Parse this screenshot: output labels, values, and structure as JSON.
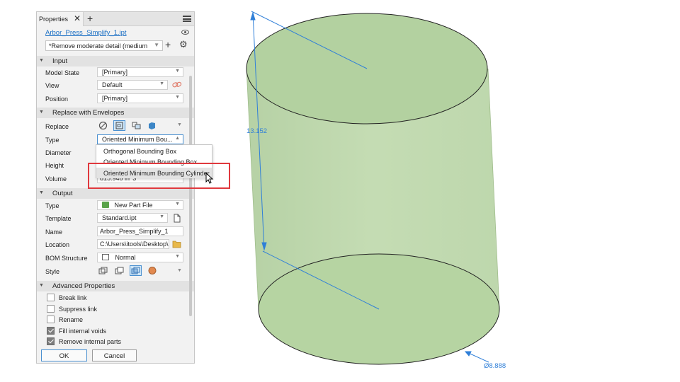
{
  "panel": {
    "tab_label": "Properties",
    "tab_close": "✕",
    "tab_add": "+",
    "file_link": "Arbor_Press_Simplify_1.ipt",
    "preset_value": "*Remove moderate detail (medium",
    "preset_add": "+",
    "gear": "⚙"
  },
  "input": {
    "title": "Input",
    "model_state_label": "Model State",
    "model_state_value": "[Primary]",
    "view_label": "View",
    "view_value": "Default",
    "position_label": "Position",
    "position_value": "[Primary]"
  },
  "envelopes": {
    "title": "Replace with Envelopes",
    "replace_label": "Replace",
    "type_label": "Type",
    "type_value": "Oriented Minimum Bou...",
    "diameter_label": "Diameter",
    "height_label": "Height",
    "volume_label": "Volume",
    "volume_value": "815.946 in^3",
    "type_options": [
      "Orthogonal Bounding Box",
      "Oriented Minimum Bounding Box",
      "Oriented Minimum Bounding Cylinder"
    ]
  },
  "output": {
    "title": "Output",
    "type_label": "Type",
    "type_value": "New Part File",
    "template_label": "Template",
    "template_value": "Standard.ipt",
    "name_label": "Name",
    "name_value": "Arbor_Press_Simplify_1",
    "location_label": "Location",
    "location_value": "C:\\Users\\itools\\Desktop\\",
    "bom_label": "BOM Structure",
    "bom_value": "Normal",
    "style_label": "Style"
  },
  "advanced": {
    "title": "Advanced Properties",
    "options": [
      {
        "label": "Break link",
        "checked": false
      },
      {
        "label": "Suppress link",
        "checked": false
      },
      {
        "label": "Rename",
        "checked": false
      },
      {
        "label": "Fill internal voids",
        "checked": true
      },
      {
        "label": "Remove internal parts",
        "checked": true
      }
    ]
  },
  "buttons": {
    "ok": "OK",
    "cancel": "Cancel"
  },
  "viewport": {
    "height_dim": "13.152",
    "diameter_dim": "Ø8.888",
    "cylinder_fill": "#b5d3a2",
    "dim_color": "#2f7fd8"
  },
  "colors": {
    "highlight_box": "#e0393e",
    "link": "#1a6fc4",
    "selected_button": "#cfe6f7"
  }
}
